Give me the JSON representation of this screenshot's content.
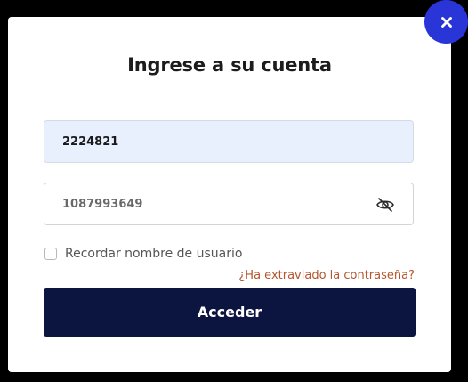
{
  "login_modal": {
    "title": "Ingrese a su cuenta",
    "username_value": "2224821",
    "password_value": "1087993649",
    "remember_label": "Recordar nombre de usuario",
    "remember_checked": false,
    "forgot_link": "¿Ha extraviado la contraseña?",
    "submit_label": "Acceder",
    "icons": {
      "close": "close-icon",
      "password_toggle": "eye-slash-icon"
    },
    "colors": {
      "close_button": "#2a35d8",
      "submit_button": "#0b1540",
      "forgot_link": "#b5552e",
      "username_field_bg": "#e8f0fe"
    }
  }
}
